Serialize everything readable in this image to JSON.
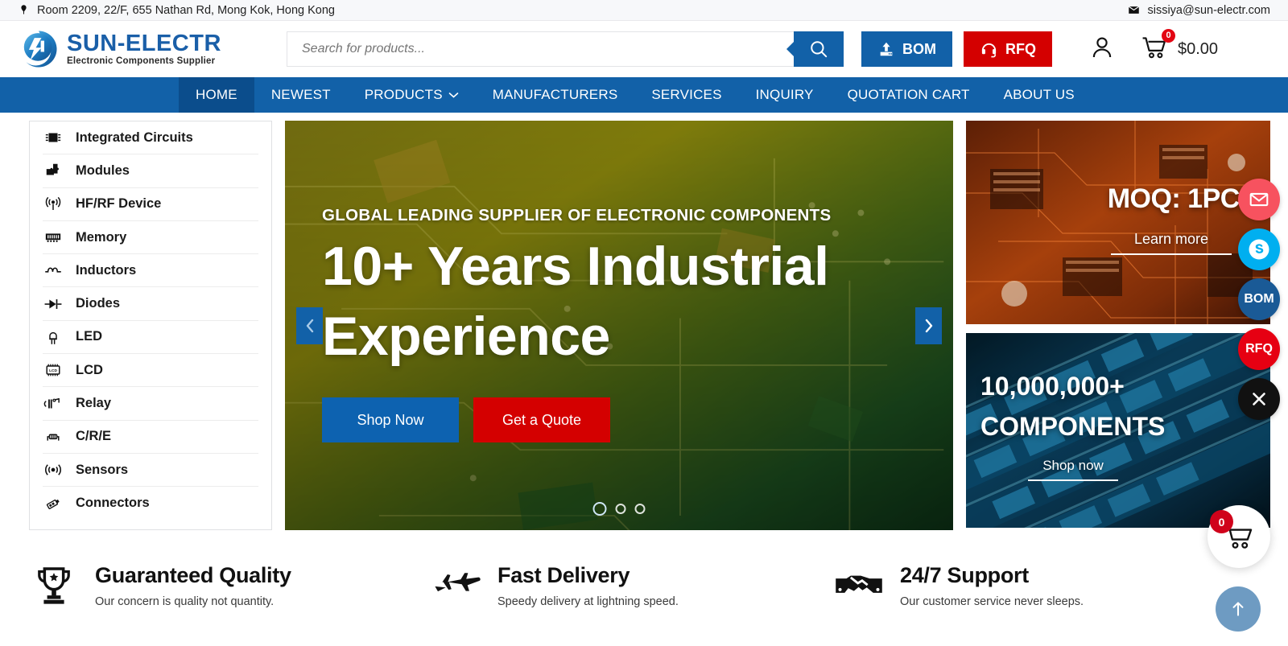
{
  "topbar": {
    "address": "Room 2209, 22/F, 655 Nathan Rd, Mong Kok, Hong Kong",
    "email": "sissiya@sun-electr.com",
    "location_icon": "map-pin-icon",
    "email_icon": "envelope-icon"
  },
  "header": {
    "logo_name": "SUN-ELECTR",
    "logo_tagline": "Electronic Components Supplier",
    "search_placeholder": "Search for products...",
    "search_value": "",
    "search_icon": "search-icon",
    "bom_label": "BOM",
    "bom_icon": "upload-icon",
    "rfq_label": "RFQ",
    "rfq_icon": "headset-icon",
    "account_icon": "user-icon",
    "cart_icon": "cart-icon",
    "cart_count": "0",
    "cart_total": "$0.00"
  },
  "nav": {
    "items": [
      {
        "label": "HOME",
        "active": true
      },
      {
        "label": "NEWEST",
        "active": false
      },
      {
        "label": "PRODUCTS",
        "active": false,
        "caret": "chevron-down-icon"
      },
      {
        "label": "MANUFACTURERS",
        "active": false
      },
      {
        "label": "SERVICES",
        "active": false
      },
      {
        "label": "INQUIRY",
        "active": false
      },
      {
        "label": "QUOTATION CART",
        "active": false
      },
      {
        "label": "ABOUT US",
        "active": false
      }
    ]
  },
  "sidebar": {
    "items": [
      {
        "label": "Integrated Circuits",
        "icon": "chip-icon"
      },
      {
        "label": "Modules",
        "icon": "puzzle-module-icon"
      },
      {
        "label": "HF/RF Device",
        "icon": "antenna-signal-icon"
      },
      {
        "label": "Memory",
        "icon": "memory-stick-icon"
      },
      {
        "label": "Inductors",
        "icon": "inductor-coil-icon"
      },
      {
        "label": "Diodes",
        "icon": "diode-icon"
      },
      {
        "label": "LED",
        "icon": "led-lamp-icon"
      },
      {
        "label": "LCD",
        "icon": "lcd-display-icon"
      },
      {
        "label": "Relay",
        "icon": "relay-switch-icon"
      },
      {
        "label": "C/R/E",
        "icon": "resistor-icon"
      },
      {
        "label": "Sensors",
        "icon": "sensor-wave-icon"
      },
      {
        "label": "Connectors",
        "icon": "connector-plug-icon"
      }
    ]
  },
  "hero": {
    "kicker": "GLOBAL LEADING SUPPLIER OF ELECTRONIC COMPONENTS",
    "title": "10+ Years Industrial Experience",
    "primary_button": "Shop Now",
    "secondary_button": "Get a Quote",
    "prev_icon": "chevron-left-icon",
    "next_icon": "chevron-right-icon",
    "slide_count": 3,
    "active_slide": 1
  },
  "promos": [
    {
      "title": "MOQ: 1PCS",
      "link": "Learn more"
    },
    {
      "title_line1": "10,000,000+",
      "title_line2": "COMPONENTS",
      "link": "Shop now"
    }
  ],
  "features": [
    {
      "title": "Guaranteed Quality",
      "subtitle": "Our concern is quality not quantity.",
      "icon": "trophy-icon"
    },
    {
      "title": "Fast Delivery",
      "subtitle": "Speedy delivery at lightning speed.",
      "icon": "jet-plane-icon"
    },
    {
      "title": "24/7 Support",
      "subtitle": "Our customer service never sleeps.",
      "icon": "handshake-icon"
    }
  ],
  "floating": {
    "buttons": [
      {
        "name": "mail",
        "label": "",
        "icon": "envelope-icon",
        "color": "#f7525f"
      },
      {
        "name": "skype",
        "label": "",
        "icon": "skype-icon",
        "color": "#00aff0"
      },
      {
        "name": "bom",
        "label": "BOM",
        "icon": "",
        "color": "#1a5a96"
      },
      {
        "name": "rfq",
        "label": "RFQ",
        "icon": "",
        "color": "#e60012"
      },
      {
        "name": "close",
        "label": "",
        "icon": "close-icon",
        "color": "#111111"
      }
    ],
    "cart_count": "0",
    "cart_icon": "cart-icon",
    "scroll_top_icon": "arrow-up-icon"
  },
  "colors": {
    "brand_blue": "#1261a8",
    "nav_active": "#0b4d8c",
    "accent_red": "#d40000",
    "logo_blue": "#1a5fa8"
  }
}
